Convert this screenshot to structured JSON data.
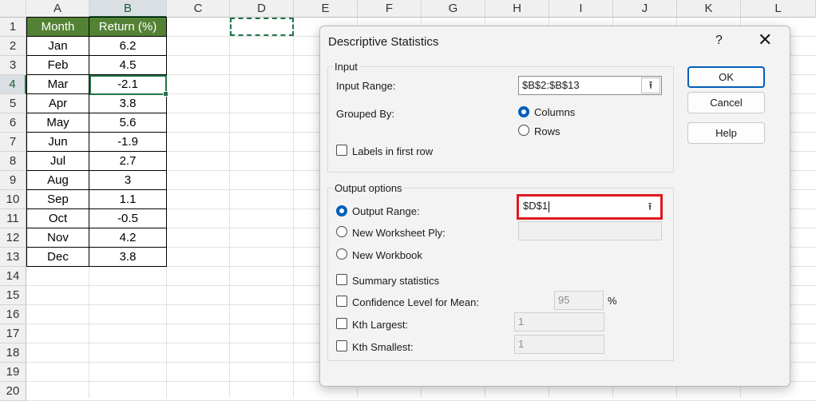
{
  "sheet": {
    "columns": [
      "A",
      "B",
      "C",
      "D",
      "E",
      "F",
      "G",
      "H",
      "I",
      "J",
      "K",
      "L"
    ],
    "rows": [
      "1",
      "2",
      "3",
      "4",
      "5",
      "6",
      "7",
      "8",
      "9",
      "10",
      "11",
      "12",
      "13",
      "14",
      "15",
      "16",
      "17",
      "18",
      "19",
      "20"
    ],
    "header": {
      "month": "Month",
      "return": "Return (%)"
    },
    "data": [
      {
        "month": "Jan",
        "value": "6.2"
      },
      {
        "month": "Feb",
        "value": "4.5"
      },
      {
        "month": "Mar",
        "value": "-2.1"
      },
      {
        "month": "Apr",
        "value": "3.8"
      },
      {
        "month": "May",
        "value": "5.6"
      },
      {
        "month": "Jun",
        "value": "-1.9"
      },
      {
        "month": "Jul",
        "value": "2.7"
      },
      {
        "month": "Aug",
        "value": "3"
      },
      {
        "month": "Sep",
        "value": "1.1"
      },
      {
        "month": "Oct",
        "value": "-0.5"
      },
      {
        "month": "Nov",
        "value": "4.2"
      },
      {
        "month": "Dec",
        "value": "3.8"
      }
    ],
    "header_fill": "#548235",
    "selection_color": "#217346"
  },
  "dialog": {
    "title": "Descriptive Statistics",
    "help_glyph": "?",
    "close_glyph": "✕",
    "input_group": "Input",
    "input_range_label": "Input Range:",
    "input_range_value": "$B$2:$B$13",
    "grouped_by_label": "Grouped By:",
    "columns_label": "Columns",
    "rows_label": "Rows",
    "labels_first_row": "Labels in first row",
    "output_group": "Output options",
    "output_range_label": "Output Range:",
    "output_range_value": "$D$1",
    "new_ply_label": "New Worksheet Ply:",
    "new_workbook_label": "New Workbook",
    "summary_stats": "Summary statistics",
    "confidence_label": "Confidence Level for Mean:",
    "confidence_value": "95",
    "percent": "%",
    "kth_largest_label": "Kth Largest:",
    "kth_largest_value": "1",
    "kth_smallest_label": "Kth Smallest:",
    "kth_smallest_value": "1",
    "ok": "OK",
    "cancel": "Cancel",
    "help": "Help",
    "collapse_icon": "⭱",
    "accent_color": "#005fb8",
    "highlight_color": "#e0171f"
  }
}
